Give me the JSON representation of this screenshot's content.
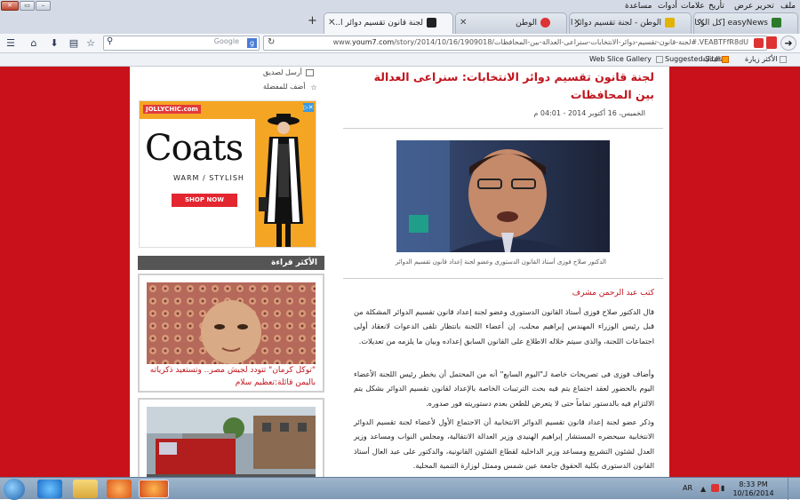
{
  "window": {
    "close_glyph": "✕",
    "max_glyph": "▭",
    "min_glyph": "–"
  },
  "menu": [
    "ملف",
    "تحرير",
    "عرض",
    "تأريخ",
    "علامات",
    "أدوات",
    "مساعدة"
  ],
  "tabs": [
    {
      "title": "easyNews [كل الوكالات]",
      "icon_color": "#2a7a2a"
    },
    {
      "title": "الوطن - لجنة تقسيم دوائر ا...",
      "icon_color": "#e2b300"
    },
    {
      "title": "الوطن",
      "icon_color": "#d33"
    },
    {
      "title": "لجنة قانون تقسيم دوائر ا...",
      "icon_color": "#222"
    }
  ],
  "new_tab_glyph": "+",
  "nav": {
    "search_placeholder": "Google",
    "url_prefix": "www.",
    "url_domain": "youm7.com",
    "url_rest": "/story/2014/10/16/1909018/لجنة-قانون-تقسيم-دوائر-الانتخابات-سنراعى-العدالة-بين-المحافظات#.VEABTFfR8dU"
  },
  "bookmarks": [
    "الأكثر زيارة",
    "البداية",
    "Suggested Sites",
    "Web Slice Gallery"
  ],
  "sidebar": {
    "send_friend": "أرسل لصديق",
    "add_fav": "أضف للمفضلة",
    "most_read_title": "الأكثر قراءة",
    "card1_caption": "\"توكل كرمان\" تتودد لجيش مصر.. وتستعيد ذكرياته باليمن قائلة:تعظيم سلام"
  },
  "ad": {
    "brand": "JOLLYCHIC.com",
    "x": "▷✕",
    "headline": "Coats",
    "sub": "WARM / STYLISH",
    "cta": "SHOP NOW"
  },
  "article": {
    "headline": "لجنة قانون تقسيم دوائر الانتخابات: سنراعى العدالة بين المحافظات",
    "dateline": "الخميس، 16 أكتوبر 2014 - 04:01 م",
    "photo_caption": "الدكتور صلاح فوزى أستاذ القانون الدستورى وعضو لجنة إعداد قانون تقسيم الدوائر",
    "byline": "كتب عبد الرحمن مشرف",
    "p1": "قال الدكتور صلاح فوزى أستاذ القانون الدستورى وعضو لجنة إعداد قانون تقسيم الدوائر المشكلة من قبل رئيس الوزراء المهندس إبراهيم محلب، إن أعضاء اللجنة بانتظار تلقى الدعوات لانعقاد أولى اجتماعات اللجنة، والذى سيتم خلاله الاطلاع على القانون السابق إعداده وبيان ما يلزمه من تعديلات.",
    "p2": "وأضاف فوزى فى تصريحات خاصة لـ\"اليوم السابع\" أنه من المحتمل أن يخطر رئيس اللجنة الأعضاء اليوم بالحضور لعقد اجتماع يتم فيه بحث الترتيبات الخاصة بالإعداد لقانون تقسيم الدوائر بشكل يتم الالتزام فيه بالدستور تماماً حتى لا يتعرض للطعن بعدم دستوريته فور صدوره.",
    "p3": "وذكر عضو لجنة إعداد قانون تقسيم الدوائر الانتخابية أن الاجتماع الأول لأعضاء لجنة تقسيم الدوائر الانتخابية سيحضره المستشار إبراهيم الهنيدى وزير العدالة الانتقالية، ومجلس النواب ومساعد وزير العدل لشئون التشريع ومساعد وزير الداخلية لقطاع الشئون القانونية، والدكتور على عبد العال أستاذ القانون الدستورى بكلية الحقوق جامعة عين شمس وممثل لوزارة التنمية المحلية."
  },
  "taskbar": {
    "lang": "AR",
    "time": "8:33 PM",
    "date": "10/16/2014"
  }
}
